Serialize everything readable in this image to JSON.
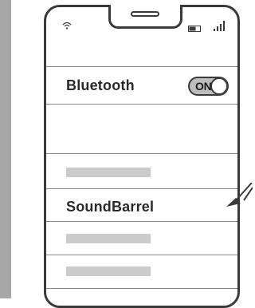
{
  "settings": {
    "bluetooth_label": "Bluetooth",
    "toggle_state_text": "ON"
  },
  "devices": {
    "device_name": "SoundBarrel"
  },
  "icons": {
    "wifi": "wifi-icon",
    "battery": "battery-icon",
    "signal": "signal-icon"
  },
  "colors": {
    "frame": "#3a3a3a",
    "toggle_fill": "#bdbdbd",
    "placeholder": "#cbcbcb",
    "side_strip": "#a7a7a7"
  }
}
